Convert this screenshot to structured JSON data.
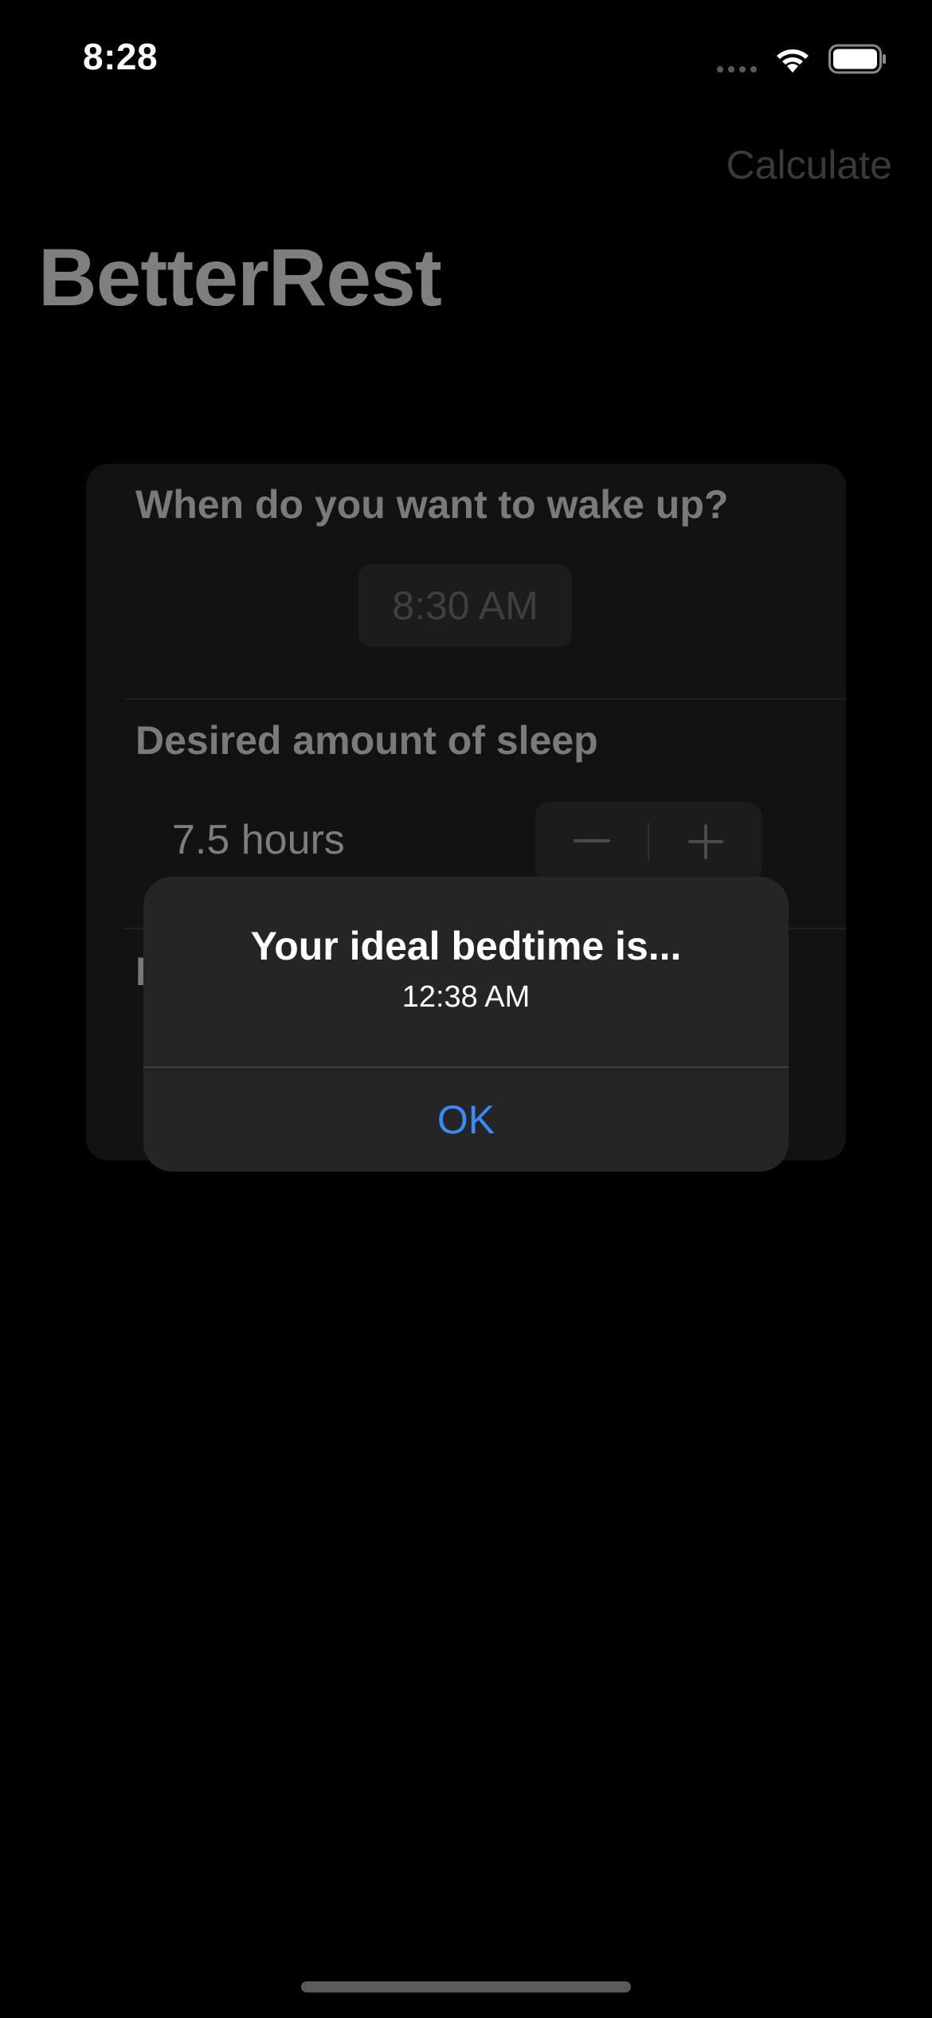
{
  "status_bar": {
    "time": "8:28",
    "signal_icon": "signal-dots-icon",
    "wifi_icon": "wifi-icon",
    "battery_icon": "battery-icon"
  },
  "nav": {
    "calculate_label": "Calculate",
    "title": "BetterRest"
  },
  "form": {
    "wake_up_label": "When do you want to wake up?",
    "wake_up_time": "8:30 AM",
    "sleep_label": "Desired amount of sleep",
    "sleep_value": "7.5 hours",
    "stepper_minus_icon": "minus-icon",
    "stepper_plus_icon": "plus-icon",
    "third_label_partial": "D"
  },
  "alert": {
    "title": "Your ideal bedtime is...",
    "message": "12:38 AM",
    "ok_label": "OK",
    "ok_color": "#3b8bf2"
  },
  "colors": {
    "background": "#000000",
    "card": "#121212",
    "alert": "#252527"
  }
}
